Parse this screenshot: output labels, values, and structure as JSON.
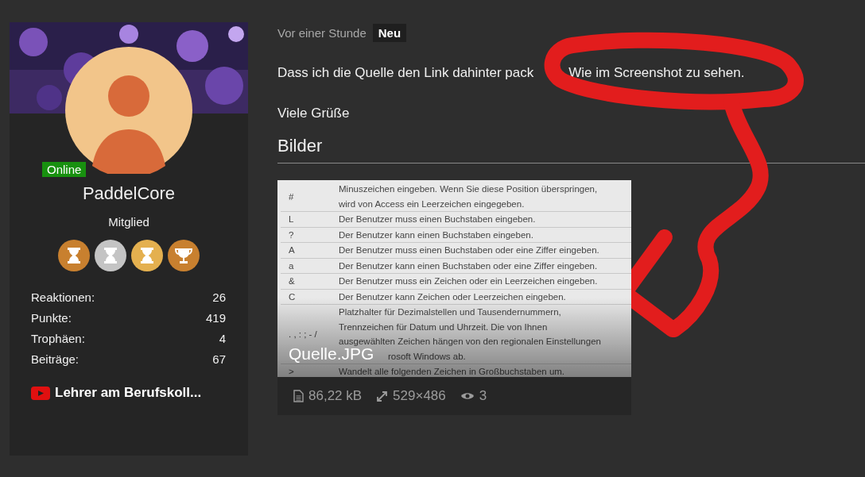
{
  "profile": {
    "name": "PaddelCore",
    "role": "Mitglied",
    "status_badge": "Online",
    "trophies": [
      {
        "kind": "hourglass",
        "color": "#c8802f"
      },
      {
        "kind": "hourglass",
        "color": "#c4c4c4"
      },
      {
        "kind": "hourglass",
        "color": "#e4b04f"
      },
      {
        "kind": "trophy",
        "color": "#c8802f"
      }
    ],
    "stats": [
      {
        "label": "Reaktionen:",
        "value": "26"
      },
      {
        "label": "Punkte:",
        "value": "419"
      },
      {
        "label": "Trophäen:",
        "value": "4"
      },
      {
        "label": "Beiträge:",
        "value": "67"
      }
    ],
    "channel_link": "Lehrer am Berufskoll..."
  },
  "post": {
    "time": "Vor einer Stunde",
    "badge": "Neu",
    "message_start": "Dass ich die Quelle den Link dahinter pack",
    "circled_text": "Wie im Screenshot zu sehen.",
    "closing": "Viele Grüße",
    "attachments": {
      "heading": "Bilder",
      "images": [
        {
          "filename": "Quelle.JPG",
          "size": "86,22 kB",
          "dimensions": "529×486",
          "views": "3",
          "preview_rows": [
            {
              "symbol": "#",
              "lines": [
                "Minuszeichen eingeben. Wenn Sie diese Position überspringen,",
                "wird von Access ein Leerzeichen eingegeben."
              ]
            },
            {
              "symbol": "L",
              "lines": [
                "Der Benutzer muss einen Buchstaben eingeben."
              ]
            },
            {
              "symbol": "?",
              "lines": [
                "Der Benutzer kann einen Buchstaben eingeben."
              ]
            },
            {
              "symbol": "A",
              "lines": [
                "Der Benutzer muss einen Buchstaben oder eine Ziffer eingeben."
              ]
            },
            {
              "symbol": "a",
              "lines": [
                "Der Benutzer kann einen Buchstaben oder eine Ziffer eingeben."
              ]
            },
            {
              "symbol": "&",
              "lines": [
                "Der Benutzer muss ein Zeichen oder ein Leerzeichen eingeben."
              ]
            },
            {
              "symbol": "C",
              "lines": [
                "Der Benutzer kann Zeichen oder Leerzeichen eingeben."
              ]
            },
            {
              "symbol": ". , : ; - /",
              "lines": [
                "Platzhalter für Dezimalstellen und Tausendernummern,",
                "Trennzeichen für Datum und Uhrzeit. Die von Ihnen",
                "ausgewählten Zeichen hängen von den regionalen Einstellungen"
              ],
              "partial_line": "rosoft Windows ab."
            },
            {
              "symbol": ">",
              "lines": [
                "Wandelt alle folgenden Zeichen in Großbuchstaben um."
              ]
            }
          ]
        }
      ]
    }
  }
}
